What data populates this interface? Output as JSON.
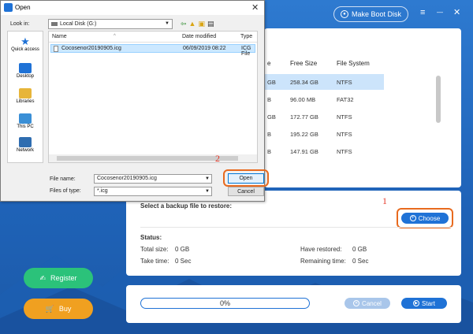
{
  "app": {
    "make_boot_disk": "Make Boot Disk",
    "win_menu": "≡",
    "win_min": "—",
    "win_close": "✕"
  },
  "disk_table": {
    "headers": [
      "e",
      "Free Size",
      "File System"
    ],
    "rows": [
      {
        "used_tail": "GB",
        "free": "258.34 GB",
        "fs": "NTFS",
        "selected": true
      },
      {
        "used_tail": "B",
        "free": "96.00 MB",
        "fs": "FAT32",
        "selected": false
      },
      {
        "used_tail": "GB",
        "free": "172.77 GB",
        "fs": "NTFS",
        "selected": false
      },
      {
        "used_tail": "B",
        "free": "195.22 GB",
        "fs": "NTFS",
        "selected": false
      },
      {
        "used_tail": "B",
        "free": "147.91 GB",
        "fs": "NTFS",
        "selected": false
      }
    ]
  },
  "restore": {
    "title": "Select a backup file to restore:",
    "choose_label": "Choose",
    "status_label": "Status:",
    "total_size_label": "Total size:",
    "total_size_value": "0 GB",
    "have_restored_label": "Have restored:",
    "have_restored_value": "0 GB",
    "take_time_label": "Take time:",
    "take_time_value": "0 Sec",
    "remaining_time_label": "Remaining time:",
    "remaining_time_value": "0 Sec"
  },
  "progress": {
    "percent_text": "0%",
    "cancel_label": "Cancel",
    "start_label": "Start"
  },
  "sidebar": {
    "register_label": "Register",
    "buy_label": "Buy"
  },
  "annotations": {
    "step1": "1",
    "step2": "2"
  },
  "dialog": {
    "title": "Open",
    "look_in_label": "Look in:",
    "look_in_value": "Local Disk (G:)",
    "places": [
      "Quick access",
      "Desktop",
      "Libraries",
      "This PC",
      "Network"
    ],
    "columns": [
      "Name",
      "Date modified",
      "Type"
    ],
    "file": {
      "name": "Cocosenor20190905.icg",
      "date": "06/09/2019 08:22",
      "type": "ICG File"
    },
    "file_name_label": "File name:",
    "file_name_value": "Cocosenor20190905.icg",
    "files_of_type_label": "Files of type:",
    "files_of_type_value": "*.icg",
    "open_label": "Open",
    "cancel_label": "Cancel"
  },
  "colors": {
    "accent": "#1f72d6",
    "highlight_ring": "#e86a1e",
    "register": "#2bc27a",
    "buy": "#f0a020",
    "annotation": "#e63a2b"
  }
}
